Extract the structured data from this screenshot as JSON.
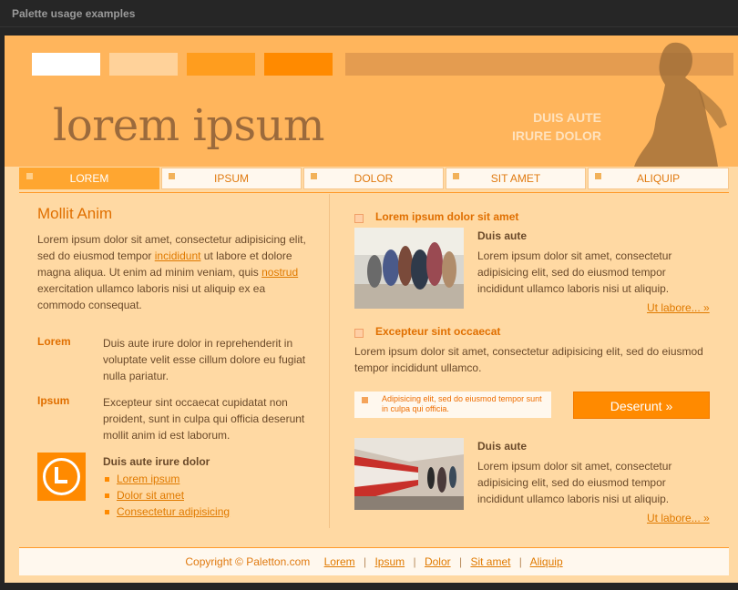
{
  "window": {
    "title": "Palette usage examples"
  },
  "header": {
    "logo": "lorem ipsum",
    "tagline_line1": "DUIS AUTE",
    "tagline_line2": "IRURE DOLOR"
  },
  "palette": [
    "#ffffff",
    "#ffd29a",
    "#ff9d1e",
    "#ff8a00",
    "#e49c50"
  ],
  "nav": {
    "items": [
      {
        "label": "LOREM"
      },
      {
        "label": "IPSUM"
      },
      {
        "label": "DOLOR"
      },
      {
        "label": "SIT AMET"
      },
      {
        "label": "ALIQUIP"
      }
    ]
  },
  "left": {
    "heading": "Mollit Anim",
    "para_a": "Lorem ipsum dolor sit amet, consectetur adipisicing elit, sed do eiusmod tempor",
    "link_1": "incididunt",
    "para_b": "ut labore et dolore magna aliqua. Ut enim ad minim veniam, quis",
    "link_2": "nostrud",
    "para_c": "exercitation ullamco laboris nisi ut aliquip ex ea commodo consequat.",
    "def1_term": "Lorem",
    "def1_text": "Duis aute irure dolor in reprehenderit in voluptate velit esse cillum dolore eu fugiat nulla pariatur.",
    "def2_term": "Ipsum",
    "def2_text": "Excepteur sint occaecat cupidatat non proident, sunt in culpa qui officia deserunt mollit anim id est laborum.",
    "links_title": "Duis aute irure dolor",
    "links": [
      "Lorem ipsum",
      "Dolor sit amet",
      "Consectetur adipisicing"
    ]
  },
  "right": {
    "section1_title": "Lorem ipsum dolor sit amet",
    "item1_title": "Duis aute",
    "item1_text": "Lorem ipsum dolor sit amet, consectetur adipisicing elit, sed do eiusmod tempor incididunt ullamco laboris nisi ut aliquip.",
    "item1_more": "Ut labore... »",
    "section2_title": "Excepteur sint occaecat",
    "section2_text": "Lorem ipsum dolor sit amet, consectetur adipisicing elit, sed do eiusmod tempor incididunt ullamco.",
    "note_text": "Adipisicing elit, sed do eiusmod tempor sunt in culpa qui officia.",
    "button_label": "Deserunt »",
    "item2_title": "Duis aute",
    "item2_text": "Lorem ipsum dolor sit amet, consectetur adipisicing elit, sed do eiusmod tempor incididunt ullamco laboris nisi ut aliquip.",
    "item2_more": "Ut labore... »"
  },
  "footer": {
    "copyright": "Copyright © Paletton.com",
    "links": [
      "Lorem",
      "Ipsum",
      "Dolor",
      "Sit amet",
      "Aliquip"
    ]
  }
}
